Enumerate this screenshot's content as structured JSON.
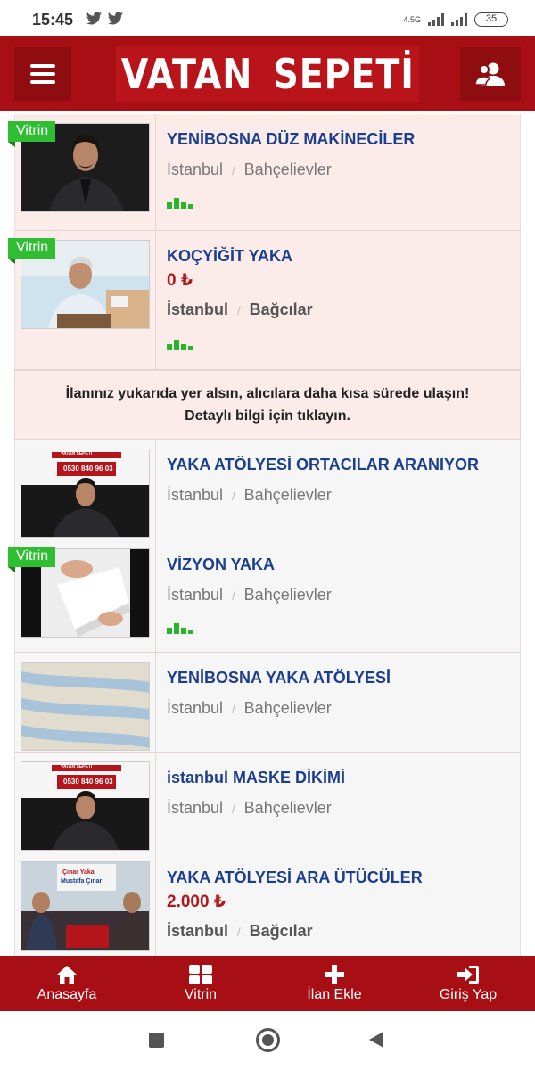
{
  "status_bar": {
    "time": "15:45",
    "left_icons": "🐦🐦",
    "network_label": "4.5G",
    "battery": "35"
  },
  "header": {
    "logo": "VATAN SEPETİ",
    "menu_icon": "hamburger-icon",
    "user_icon": "users-icon",
    "brand_color": "#a80f14"
  },
  "listings": [
    {
      "badge": "Vitrin",
      "title": "YENİBOSNA DÜZ MAKİNECİLER",
      "price": "",
      "city": "İstanbul",
      "district": "Bahçelievler",
      "featured": true,
      "bars": true
    },
    {
      "badge": "Vitrin",
      "title": "KOÇYİĞİT YAKA",
      "price": "0 ₺",
      "city": "İstanbul",
      "district": "Bağcılar",
      "featured": true,
      "bars": true
    },
    {
      "badge": "",
      "title": "YAKA ATÖLYESİ ORTACILAR ARANIYOR",
      "price": "",
      "city": "İstanbul",
      "district": "Bahçelievler",
      "featured": false,
      "bars": false
    },
    {
      "badge": "Vitrin",
      "title": "VİZYON YAKA",
      "price": "",
      "city": "İstanbul",
      "district": "Bahçelievler",
      "featured": false,
      "bars": true
    },
    {
      "badge": "",
      "title": "YENİBOSNA YAKA ATÖLYESİ",
      "price": "",
      "city": "İstanbul",
      "district": "Bahçelievler",
      "featured": false,
      "bars": false
    },
    {
      "badge": "",
      "title": "istanbul MASKE DİKİMİ",
      "price": "",
      "city": "İstanbul",
      "district": "Bahçelievler",
      "featured": false,
      "bars": false
    },
    {
      "badge": "",
      "title": "YAKA ATÖLYESİ ARA ÜTÜCÜLER",
      "price": "2.000 ₺",
      "city": "İstanbul",
      "district": "Bağcılar",
      "featured": false,
      "bars": false
    }
  ],
  "promo": {
    "line1": "İlanınız yukarıda yer alsın, alıcılara daha kısa sürede ulaşın!",
    "line2": "Detaylı bilgi için tıklayın."
  },
  "thumb_texts": {
    "phone_banner": "0530 840 96 03",
    "banner_top": "VATAN SEPETİ",
    "cimar_line1": "Çınar Yaka",
    "cimar_line2": "Mustafa Çınar"
  },
  "bottom_nav": [
    {
      "label": "Anasayfa",
      "icon": "home-icon"
    },
    {
      "label": "Vitrin",
      "icon": "grid-icon"
    },
    {
      "label": "İlan Ekle",
      "icon": "plus-icon"
    },
    {
      "label": "Giriş Yap",
      "icon": "login-icon"
    }
  ]
}
